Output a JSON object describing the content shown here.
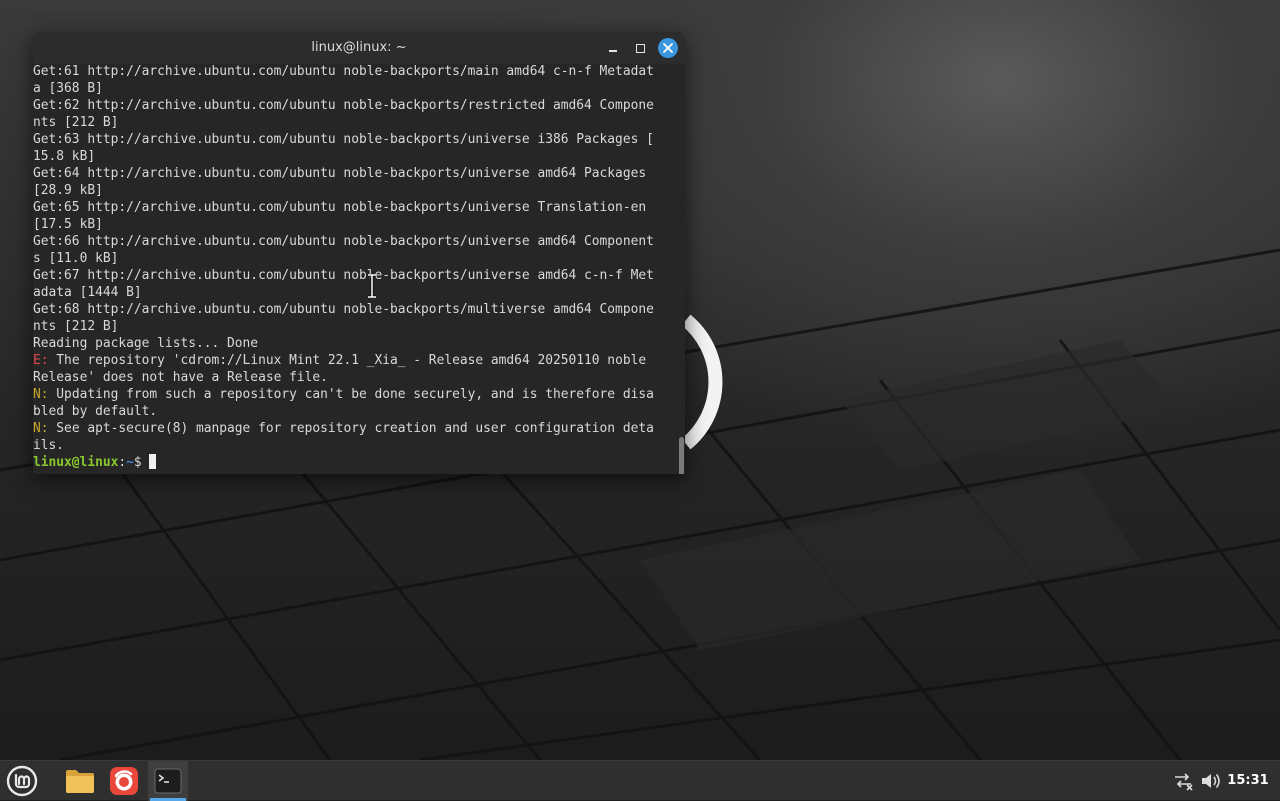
{
  "window": {
    "title": "linux@linux: ~",
    "lines": [
      {
        "text": "Get:61 http://archive.ubuntu.com/ubuntu noble-backports/main amd64 c-n-f Metadat"
      },
      {
        "text": "a [368 B]"
      },
      {
        "text": "Get:62 http://archive.ubuntu.com/ubuntu noble-backports/restricted amd64 Compone"
      },
      {
        "text": "nts [212 B]"
      },
      {
        "text": "Get:63 http://archive.ubuntu.com/ubuntu noble-backports/universe i386 Packages ["
      },
      {
        "text": "15.8 kB]"
      },
      {
        "text": "Get:64 http://archive.ubuntu.com/ubuntu noble-backports/universe amd64 Packages"
      },
      {
        "text": "[28.9 kB]"
      },
      {
        "text": "Get:65 http://archive.ubuntu.com/ubuntu noble-backports/universe Translation-en"
      },
      {
        "text": "[17.5 kB]"
      },
      {
        "text": "Get:66 http://archive.ubuntu.com/ubuntu noble-backports/universe amd64 Component"
      },
      {
        "text": "s [11.0 kB]"
      },
      {
        "text": "Get:67 http://archive.ubuntu.com/ubuntu noble-backports/universe amd64 c-n-f Met"
      },
      {
        "text": "adata [1444 B]"
      },
      {
        "text": "Get:68 http://archive.ubuntu.com/ubuntu noble-backports/multiverse amd64 Compone"
      },
      {
        "text": "nts [212 B]"
      },
      {
        "text": "Reading package lists... Done"
      },
      {
        "prefix": "E:",
        "text": " The repository 'cdrom://Linux Mint 22.1 _Xia_ - Release amd64 20250110 noble"
      },
      {
        "text": "Release' does not have a Release file."
      },
      {
        "prefix": "N:",
        "text": " Updating from such a repository can't be done securely, and is therefore disa"
      },
      {
        "text": "bled by default."
      },
      {
        "prefix": "N:",
        "text": " See apt-secure(8) manpage for repository creation and user configuration deta"
      },
      {
        "text": "ils."
      }
    ],
    "prompt": {
      "user": "linux@linux",
      "sep": ":",
      "path": "~",
      "symbol": "$"
    }
  },
  "colors": {
    "error_prefix": "#e0454b",
    "note_prefix": "#c6a52a",
    "prompt_user": "#8ac82e",
    "prompt_path": "#4aa3ff",
    "close_button": "#3a96dd"
  },
  "taskbar": {
    "items": [
      {
        "name": "menu",
        "icon": "linux-mint-logo-icon"
      },
      {
        "name": "files",
        "icon": "folder-icon"
      },
      {
        "name": "firefox",
        "icon": "firefox-icon"
      },
      {
        "name": "terminal",
        "icon": "terminal-icon",
        "active": true
      }
    ],
    "tray": [
      "network-disconnected-icon",
      "volume-icon"
    ],
    "clock": "15:31"
  }
}
